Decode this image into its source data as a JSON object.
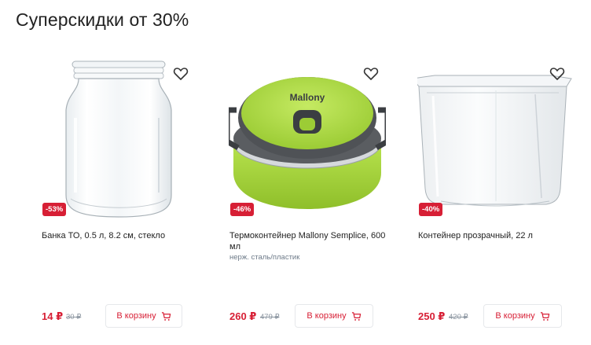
{
  "section": {
    "title": "Суперскидки от 30%"
  },
  "products": [
    {
      "discount": "-53%",
      "name": "Банка ТО, 0.5 л, 8.2 см, стекло",
      "meta": "",
      "price": "14 ₽",
      "old_price": "30 ₽",
      "cart_label": "В корзину",
      "image_icon": "glass-jar-icon"
    },
    {
      "discount": "-46%",
      "name": "Термоконтейнер Mallony Semplice, 600 мл",
      "meta": "нерж. сталь/пластик",
      "price": "260 ₽",
      "old_price": "479 ₽",
      "cart_label": "В корзину",
      "image_icon": "lunch-container-icon",
      "brand_on_image": "Mallony"
    },
    {
      "discount": "-40%",
      "name": "Контейнер прозрачный, 22 л",
      "meta": "",
      "price": "250 ₽",
      "old_price": "420 ₽",
      "cart_label": "В корзину",
      "image_icon": "plastic-box-icon"
    }
  ],
  "colors": {
    "accent": "#d71f35",
    "meta_text": "#6e7b89",
    "container_green": "#9fd23a"
  }
}
